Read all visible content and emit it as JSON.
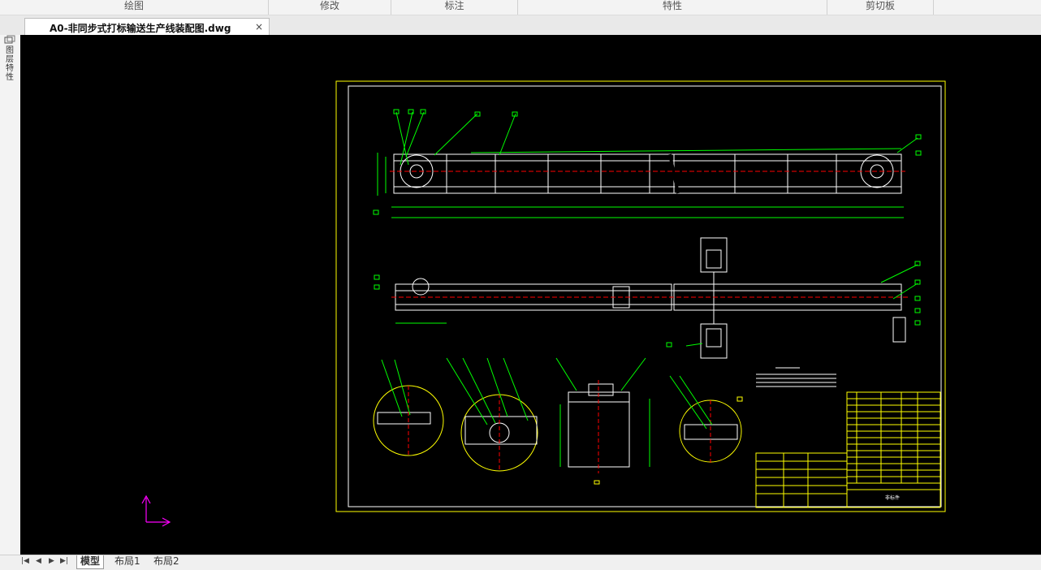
{
  "ribbon": {
    "groups": [
      "绘图",
      "修改",
      "标注",
      "特性",
      "剪切板"
    ]
  },
  "document": {
    "tab_title": "A0-非同步式打标输送生产线装配图.dwg",
    "close_glyph": "×"
  },
  "side_panel": {
    "icon": "layers-icon",
    "label": "图层特性"
  },
  "layout_tabs": {
    "nav": [
      "|◀",
      "◀",
      "▶",
      "▶|"
    ],
    "tabs": [
      "模型",
      "布局1",
      "布局2"
    ],
    "active": "模型"
  },
  "drawing": {
    "title_block_text": "非标件",
    "colors": {
      "background": "#000000",
      "frame": "#ffff00",
      "geometry": "#ffffff",
      "dimension": "#00ff00",
      "centerline": "#ff0000",
      "ucs": "#ff00ff",
      "highlight": "#00ffff"
    }
  }
}
